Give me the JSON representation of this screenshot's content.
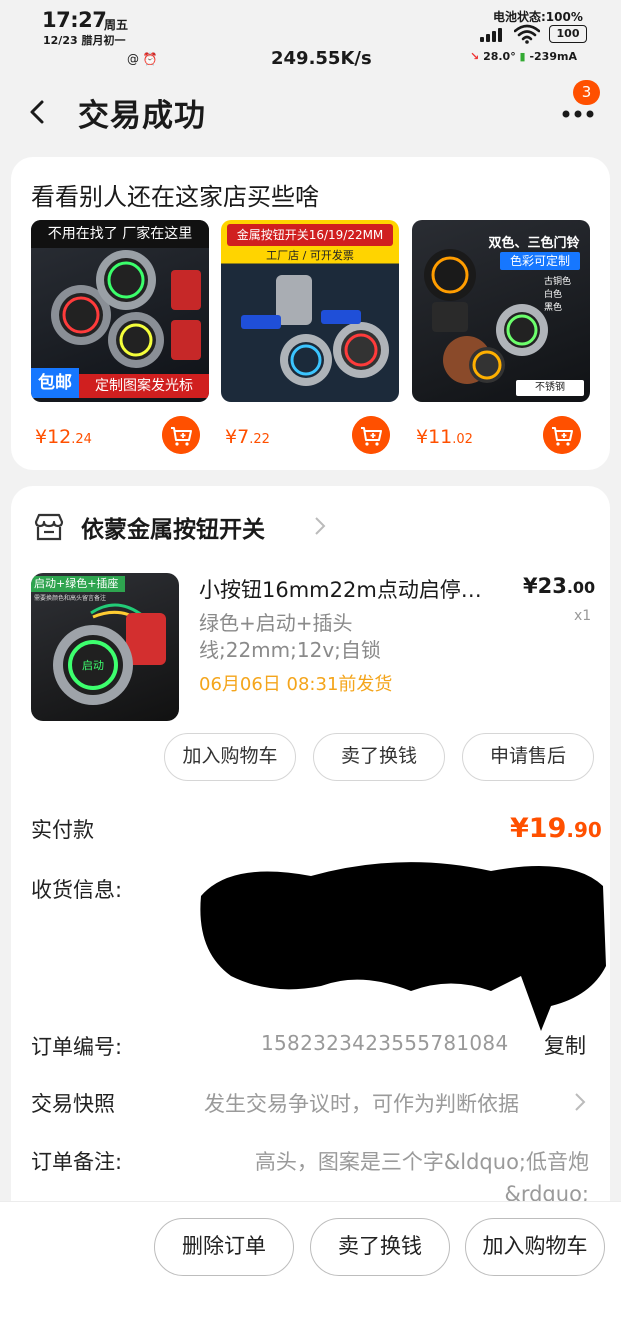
{
  "status_bar": {
    "time": "17:27",
    "weekday": "周五",
    "date": "12/23 腊月初一",
    "network_speed": "249.55K/s",
    "battery_status": "电池状态:100%",
    "battery_level": "100",
    "temperature": "28.0°",
    "current": "-239mA"
  },
  "header": {
    "title": "交易成功",
    "badge_count": "3"
  },
  "recommend": {
    "title": "看看别人还在这家店买些啥",
    "items": [
      {
        "price_int": "¥12",
        "price_dec": ".24",
        "banner_top": "不用在找了 厂家在这里",
        "badge": "包邮",
        "banner_bottom": "定制图案发光标"
      },
      {
        "price_int": "¥7",
        "price_dec": ".22",
        "banner_top": "金属按钮开关16/19/22MM",
        "banner_sub": "工厂店 / 可开发票"
      },
      {
        "price_int": "¥11",
        "price_dec": ".02",
        "banner_top": "双色、三色门铃",
        "banner_sub": "色彩可定制",
        "tag": "不锈钢",
        "options": [
          "古铜色",
          "白色",
          "黑色"
        ]
      }
    ]
  },
  "order": {
    "shop_name": "依蒙金属按钮开关",
    "product": {
      "title": "小按钮16mm22m点动启停…",
      "price_int": "¥23",
      "price_dec": ".00",
      "qty": "x1",
      "sku_line1": "绿色+启动+插头",
      "sku_line2": "线;22mm;12v;自锁",
      "ship_time": "06月06日 08:31前发货",
      "img_banner": "启动+绿色+插座",
      "img_sub": "需要换颜色和高头留言备注",
      "img_button_text": "启动"
    },
    "actions": [
      "加入购物车",
      "卖了换钱",
      "申请售后"
    ],
    "paid_label": "实付款",
    "paid_int": "¥19",
    "paid_dec": ".90",
    "address_label": "收货信息:",
    "order_no_label": "订单编号:",
    "order_no": "1582323423555781084",
    "copy": "复制",
    "snapshot_label": "交易快照",
    "snapshot_text": "发生交易争议时，可作为判断依据",
    "note_label": "订单备注:",
    "note_text": "高头，图案是三个字&ldquo;低音炮&rdquo;"
  },
  "bottom_bar": {
    "buttons": [
      "删除订单",
      "卖了换钱",
      "加入购物车"
    ]
  },
  "colors": {
    "accent": "#ff5000",
    "ship": "#f4a51c"
  }
}
